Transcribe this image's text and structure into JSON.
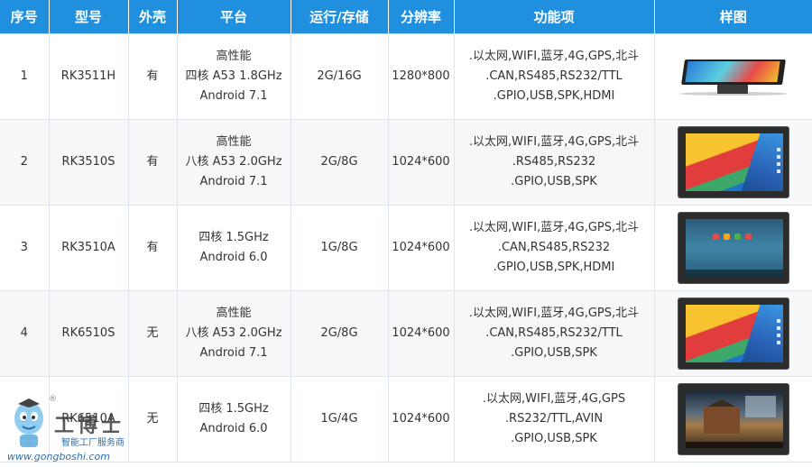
{
  "headers": [
    "序号",
    "型号",
    "外壳",
    "平台",
    "运行/存储",
    "分辨率",
    "功能项",
    "样图"
  ],
  "rows": [
    {
      "index": "1",
      "model": "RK3511H",
      "shell": "有",
      "platform": [
        "高性能",
        "四核 A53 1.8GHz",
        "Android 7.1"
      ],
      "memory": "2G/16G",
      "resolution": "1280*800",
      "features": [
        ".以太网,WIFI,蓝牙,4G,GPS,北斗",
        ".CAN,RS485,RS232/TTL",
        ".GPIO,USB,SPK,HDMI"
      ],
      "image": "angled-panel"
    },
    {
      "index": "2",
      "model": "RK3510S",
      "shell": "有",
      "platform": [
        "高性能",
        "八核 A53 2.0GHz",
        "Android 7.1"
      ],
      "memory": "2G/8G",
      "resolution": "1024*600",
      "features": [
        ".以太网,WIFI,蓝牙,4G,GPS,北斗",
        ".RS485,RS232",
        ".GPIO,USB,SPK"
      ],
      "image": "material-wallpaper"
    },
    {
      "index": "3",
      "model": "RK3510A",
      "shell": "有",
      "platform": [
        "四核 1.5GHz",
        "Android 6.0"
      ],
      "memory": "1G/8G",
      "resolution": "1024*600",
      "features": [
        ".以太网,WIFI,蓝牙,4G,GPS,北斗",
        ".CAN,RS485,RS232",
        ".GPIO,USB,SPK,HDMI"
      ],
      "image": "android-home"
    },
    {
      "index": "4",
      "model": "RK6510S",
      "shell": "无",
      "platform": [
        "高性能",
        "八核 A53 2.0GHz",
        "Android 7.1"
      ],
      "memory": "2G/8G",
      "resolution": "1024*600",
      "features": [
        ".以太网,WIFI,蓝牙,4G,GPS,北斗",
        ".CAN,RS485,RS232/TTL",
        ".GPIO,USB,SPK"
      ],
      "image": "material-wallpaper"
    },
    {
      "index": "5",
      "model": "RK6510A",
      "shell": "无",
      "platform": [
        "四核 1.5GHz",
        "Android 6.0"
      ],
      "memory": "1G/4G",
      "resolution": "1024*600",
      "features": [
        ".以太网,WIFI,蓝牙,4G,GPS",
        ".RS232/TTL,AVIN",
        ".GPIO,USB,SPK"
      ],
      "image": "photo-screen"
    }
  ],
  "watermark": {
    "brand": "工博士",
    "subtitle": "智能工厂服务商",
    "url": "www.gongboshi.com",
    "reg": "®"
  },
  "colors": {
    "header_bg": "#1f8fde",
    "header_text": "#ffffff",
    "row_alt": "#f6f7f9"
  }
}
